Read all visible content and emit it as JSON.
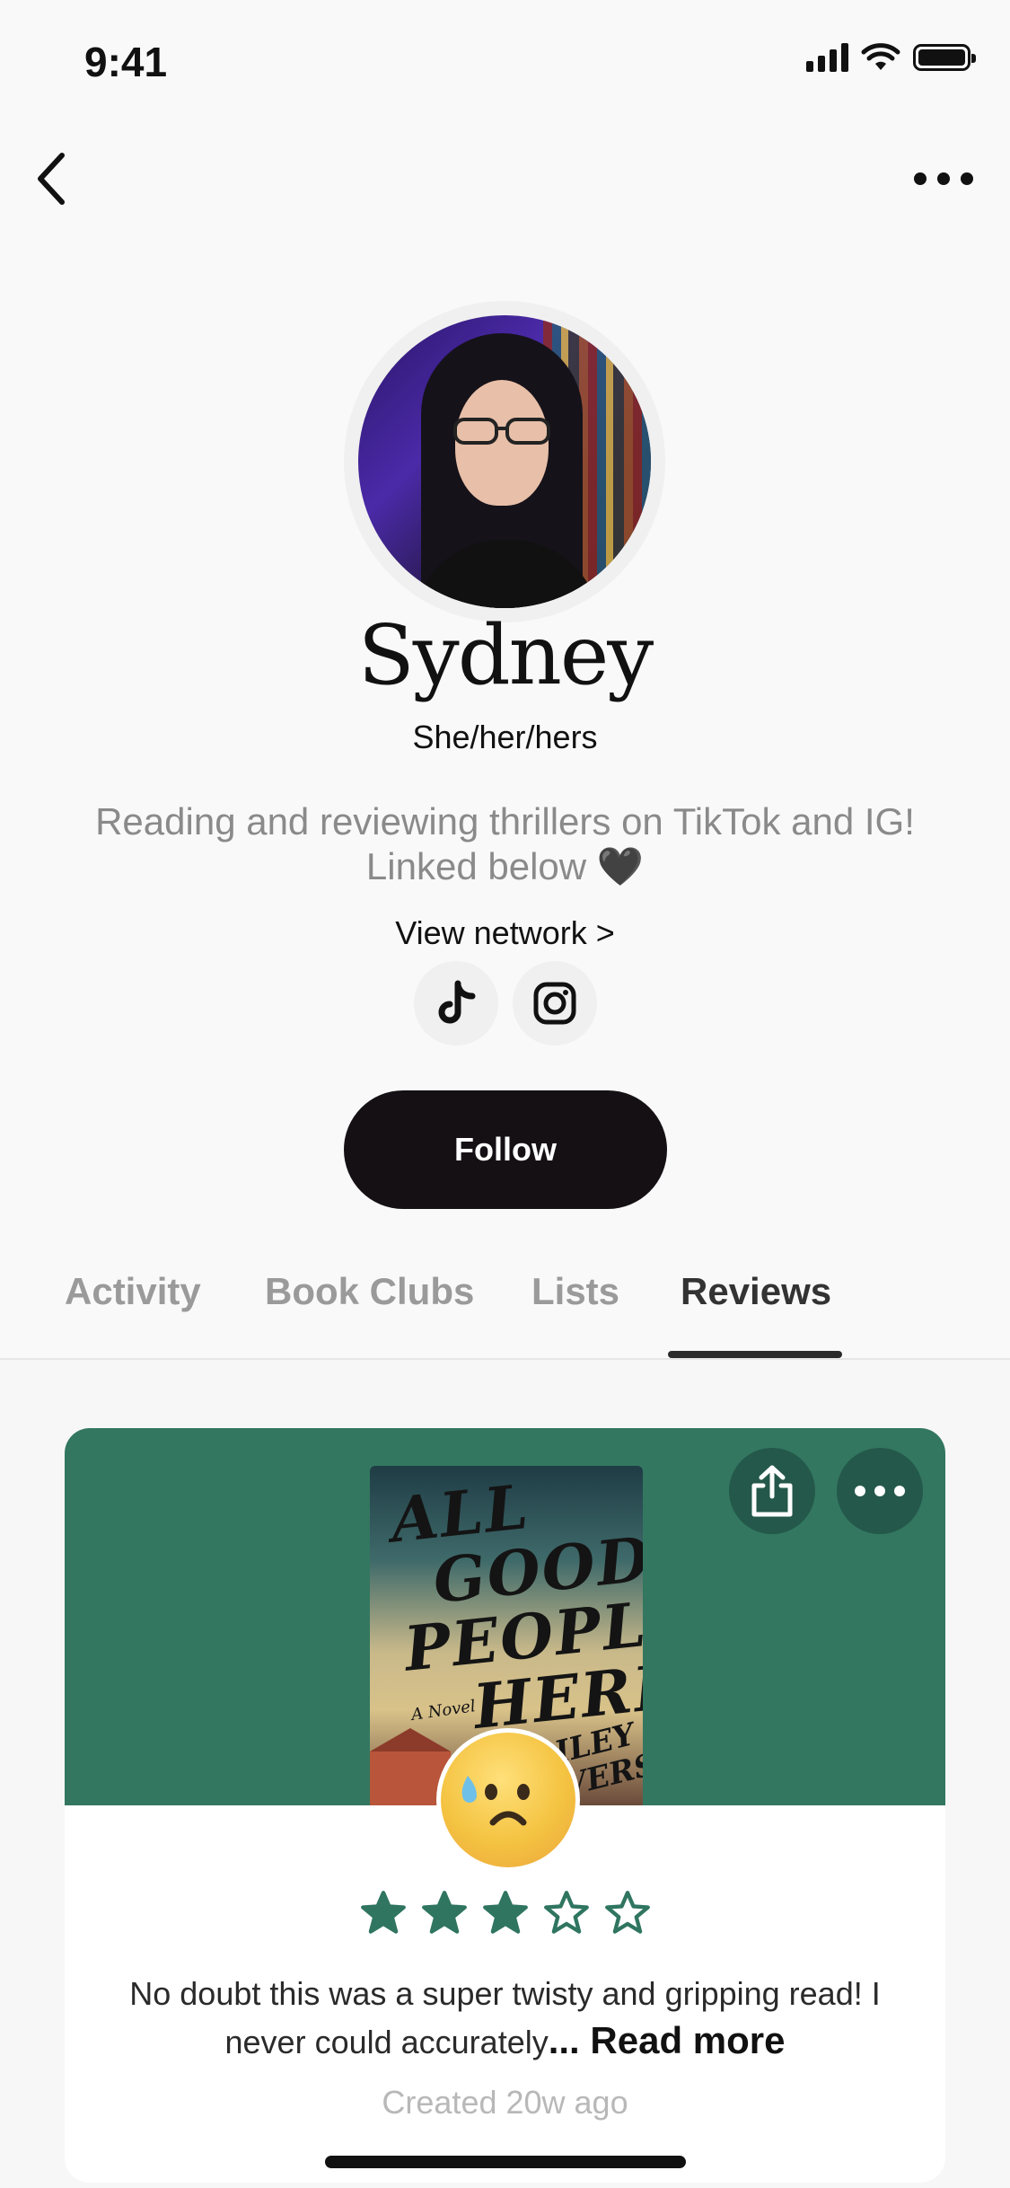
{
  "status_bar": {
    "time": "9:41"
  },
  "profile": {
    "name": "Sydney",
    "pronouns": "She/her/hers",
    "bio": "Reading and reviewing thrillers on TikTok and IG! Linked below 🖤",
    "view_network": "View network >",
    "follow_label": "Follow",
    "socials": [
      "tiktok-icon",
      "instagram-icon"
    ]
  },
  "tabs": [
    {
      "label": "Activity",
      "active": false
    },
    {
      "label": "Book Clubs",
      "active": false
    },
    {
      "label": "Lists",
      "active": false
    },
    {
      "label": "Reviews",
      "active": true
    }
  ],
  "review": {
    "book": {
      "title_lines": [
        "ALL",
        "GOOD",
        "PEOPLE",
        "HERE"
      ],
      "subtitle": "A Novel",
      "author_fragment": "ILEY\nVERS"
    },
    "header_color": "#337760",
    "reaction": "anxious-sweat-face",
    "rating": 3,
    "rating_max": 5,
    "text": "No doubt this was a super twisty and gripping read! I never could accurately",
    "read_more": "... Read more",
    "created": "Created 20w ago"
  }
}
